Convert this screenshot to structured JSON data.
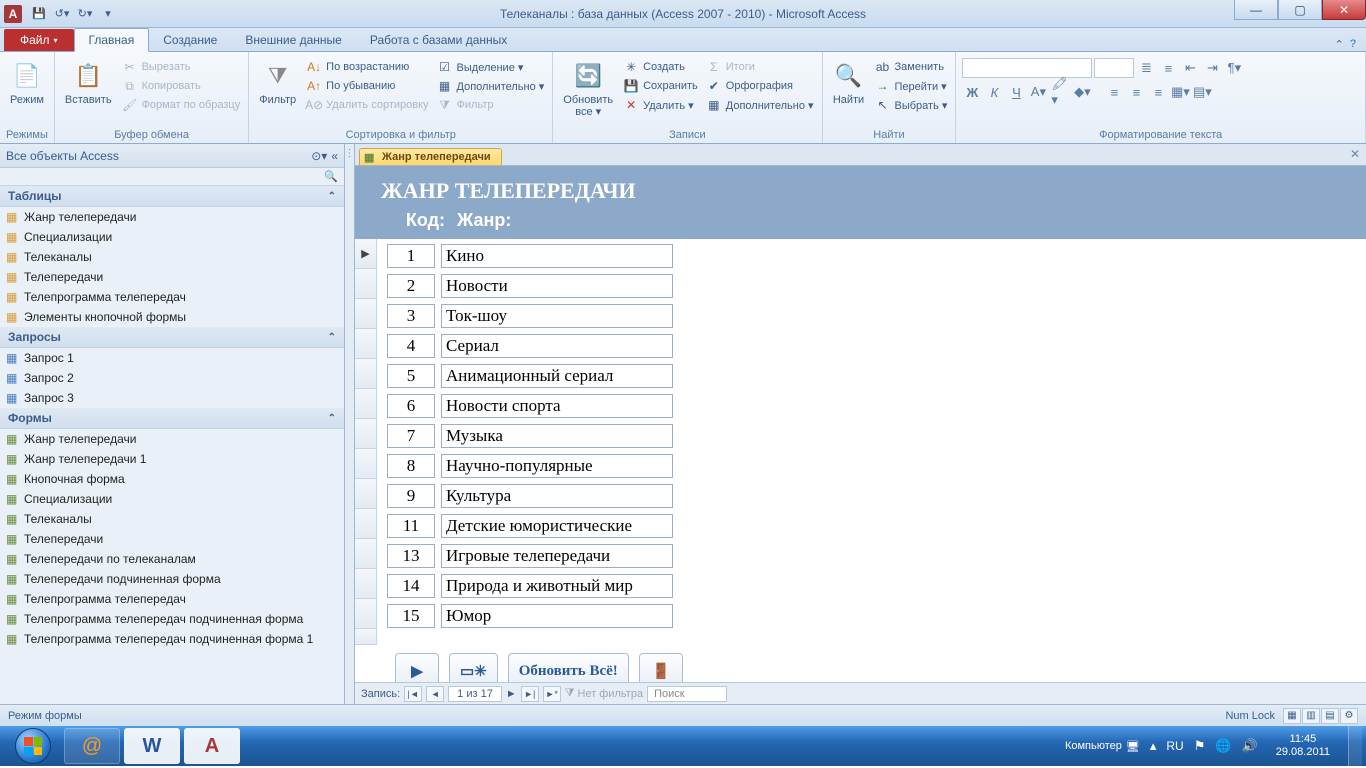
{
  "titlebar": {
    "title": "Телеканалы : база данных (Access 2007 - 2010)  -  Microsoft Access"
  },
  "ribbon": {
    "file": "Файл",
    "tabs": [
      "Главная",
      "Создание",
      "Внешние данные",
      "Работа с базами данных"
    ],
    "active_tab": 0,
    "groups": {
      "modes": {
        "label": "Режимы",
        "mode": "Режим"
      },
      "clipboard": {
        "label": "Буфер обмена",
        "paste": "Вставить",
        "cut": "Вырезать",
        "copy": "Копировать",
        "fmtpainter": "Формат по образцу"
      },
      "sortfilter": {
        "label": "Сортировка и фильтр",
        "filter": "Фильтр",
        "asc": "По возрастанию",
        "desc": "По убыванию",
        "clearsort": "Удалить сортировку",
        "selection": "Выделение ▾",
        "advanced": "Дополнительно ▾",
        "togglefilter": "Фильтр"
      },
      "records": {
        "label": "Записи",
        "refresh": "Обновить\nвсе ▾",
        "new": "Создать",
        "save": "Сохранить",
        "delete": "Удалить ▾",
        "totals": "Итоги",
        "spelling": "Орфография",
        "more": "Дополнительно ▾"
      },
      "find": {
        "label": "Найти",
        "find": "Найти",
        "replace": "Заменить",
        "goto": "Перейти ▾",
        "select": "Выбрать ▾"
      },
      "format": {
        "label": "Форматирование текста"
      }
    }
  },
  "navpane": {
    "header": "Все объекты Access",
    "groups": [
      {
        "title": "Таблицы",
        "type": "table",
        "items": [
          "Жанр телепередачи",
          "Специализации",
          "Телеканалы",
          "Телепередачи",
          "Телепрограмма телепередач",
          "Элементы кнопочной формы"
        ]
      },
      {
        "title": "Запросы",
        "type": "query",
        "items": [
          "Запрос 1",
          "Запрос 2",
          "Запрос 3"
        ]
      },
      {
        "title": "Формы",
        "type": "form",
        "items": [
          "Жанр телепередачи",
          "Жанр телепередачи 1",
          "Кнопочная форма",
          "Специализации",
          "Телеканалы",
          "Телепередачи",
          "Телепередачи по телеканалам",
          "Телепередачи подчиненная форма",
          "Телепрограмма телепередач",
          "Телепрограмма телепередач подчиненная форма",
          "Телепрограмма телепередач подчиненная форма 1"
        ]
      }
    ]
  },
  "document": {
    "tab": "Жанр телепередачи",
    "form_title": "ЖАНР ТЕЛЕПЕРЕДАЧИ",
    "col1": "Код:",
    "col2": "Жанр:",
    "records": [
      {
        "code": "1",
        "genre": "Кино"
      },
      {
        "code": "2",
        "genre": "Новости"
      },
      {
        "code": "3",
        "genre": "Ток-шоу"
      },
      {
        "code": "4",
        "genre": "Сериал"
      },
      {
        "code": "5",
        "genre": "Анимационный сериал"
      },
      {
        "code": "6",
        "genre": "Новости спорта"
      },
      {
        "code": "7",
        "genre": "Музыка"
      },
      {
        "code": "8",
        "genre": "Научно-популярные"
      },
      {
        "code": "9",
        "genre": "Культура"
      },
      {
        "code": "11",
        "genre": "Детские юмористические"
      },
      {
        "code": "13",
        "genre": "Игровые телепередачи"
      },
      {
        "code": "14",
        "genre": "Природа и животный мир"
      },
      {
        "code": "15",
        "genre": "Юмор"
      }
    ],
    "buttons": {
      "refresh_all": "Обновить Всё!"
    },
    "recnav": {
      "label": "Запись:",
      "pos": "1 из 17",
      "filter": "Нет фильтра",
      "search": "Поиск"
    }
  },
  "statusbar": {
    "mode": "Режим формы",
    "numlock": "Num Lock"
  },
  "taskbar": {
    "computer": "Компьютер",
    "lang": "RU",
    "time": "11:45",
    "date": "29.08.2011"
  }
}
